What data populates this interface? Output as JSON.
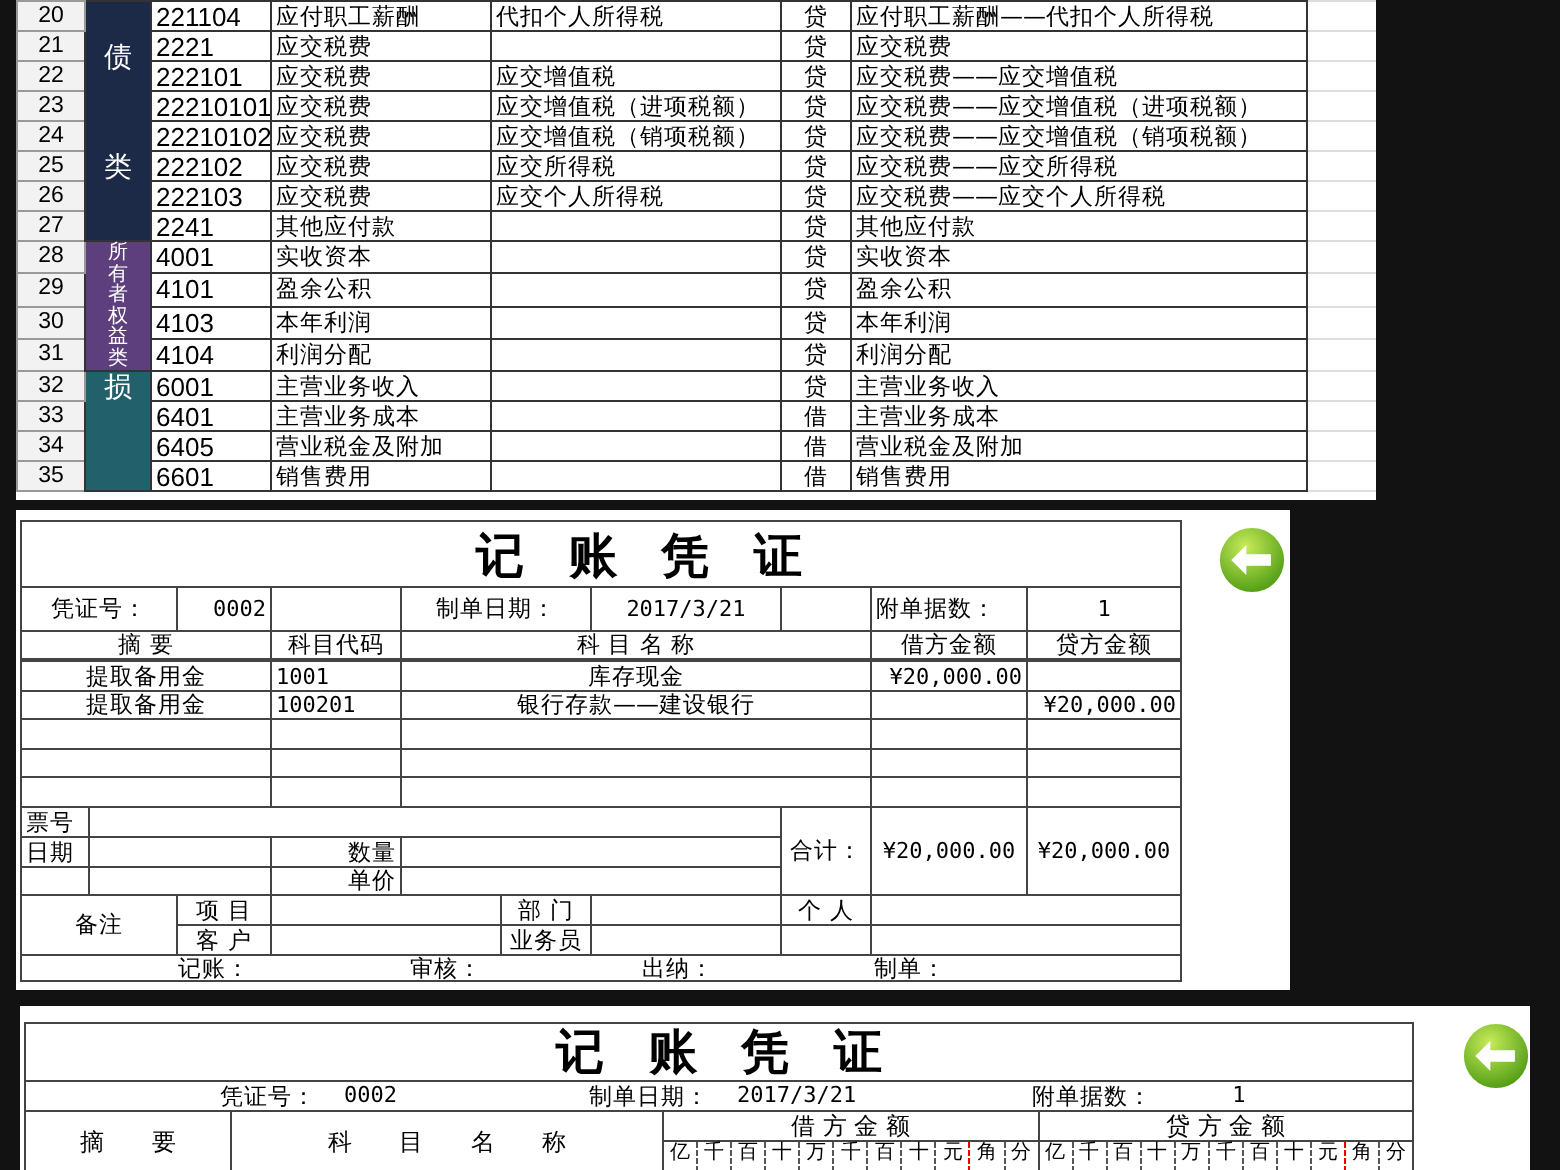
{
  "sheet": {
    "groups": [
      {
        "labels": [
          "债",
          "类"
        ],
        "color": "#1c2a48",
        "rows": [
          {
            "row_number": "20",
            "code": "221104",
            "name": "应付职工薪酬",
            "detail": "代扣个人所得税",
            "direction": "贷",
            "full_name": "应付职工薪酬——代扣个人所得税"
          },
          {
            "row_number": "21",
            "code": "2221",
            "name": "应交税费",
            "direction": "贷",
            "full_name": "应交税费"
          },
          {
            "row_number": "22",
            "code": "222101",
            "name": "应交税费",
            "detail": "应交增值税",
            "direction": "贷",
            "full_name": "应交税费——应交增值税"
          },
          {
            "row_number": "23",
            "code": "22210101",
            "name": "应交税费",
            "detail": "应交增值税（进项税额）",
            "direction": "贷",
            "full_name": "应交税费——应交增值税（进项税额）"
          },
          {
            "row_number": "24",
            "code": "22210102",
            "name": "应交税费",
            "detail": "应交增值税（销项税额）",
            "direction": "贷",
            "full_name": "应交税费——应交增值税（销项税额）"
          },
          {
            "row_number": "25",
            "code": "222102",
            "name": "应交税费",
            "detail": "应交所得税",
            "direction": "贷",
            "full_name": "应交税费——应交所得税"
          },
          {
            "row_number": "26",
            "code": "222103",
            "name": "应交税费",
            "detail": "应交个人所得税",
            "direction": "贷",
            "full_name": "应交税费——应交个人所得税"
          },
          {
            "row_number": "27",
            "code": "2241",
            "name": "其他应付款",
            "direction": "贷",
            "full_name": "其他应付款"
          }
        ]
      },
      {
        "labels": [
          "所有者权益类"
        ],
        "color": "#5e3f7e",
        "rows": [
          {
            "row_number": "28",
            "code": "4001",
            "name": "实收资本",
            "direction": "贷",
            "full_name": "实收资本"
          },
          {
            "row_number": "29",
            "code": "4101",
            "name": "盈余公积",
            "direction": "贷",
            "full_name": "盈余公积"
          },
          {
            "row_number": "30",
            "code": "4103",
            "name": "本年利润",
            "direction": "贷",
            "full_name": "本年利润"
          },
          {
            "row_number": "31",
            "code": "4104",
            "name": "利润分配",
            "direction": "贷",
            "full_name": "利润分配"
          }
        ]
      },
      {
        "labels": [
          "损"
        ],
        "color": "#22606c",
        "rows": [
          {
            "row_number": "32",
            "code": "6001",
            "name": "主营业务收入",
            "direction": "贷",
            "full_name": "主营业务收入"
          },
          {
            "row_number": "33",
            "code": "6401",
            "name": "主营业务成本",
            "direction": "借",
            "full_name": "主营业务成本"
          },
          {
            "row_number": "34",
            "code": "6405",
            "name": "营业税金及附加",
            "direction": "借",
            "full_name": "营业税金及附加"
          },
          {
            "row_number": "35",
            "code": "6601",
            "name": "销售费用",
            "direction": "借",
            "full_name": "销售费用"
          }
        ]
      }
    ]
  },
  "voucher": {
    "title": "记 账 凭 证",
    "number_label": "凭证号：",
    "number": "0002",
    "date_label": "制单日期：",
    "date": "2017/3/21",
    "attachments_label": "附单据数：",
    "attachments": "1",
    "columns": [
      "摘  要",
      "科目代码",
      "科  目  名  称",
      "借方金额",
      "贷方金额"
    ],
    "entries": [
      {
        "summary": "提取备用金",
        "code": "1001",
        "account": "库存现金",
        "debit": "¥20,000.00"
      },
      {
        "summary": "提取备用金",
        "code": "100201",
        "account": "银行存款——建设银行",
        "credit": "¥20,000.00"
      }
    ],
    "ticket_label": "票号",
    "date2_label": "日期",
    "quantity_label": "数量",
    "price_label": "单价",
    "total_label": "合计：",
    "total_debit": "¥20,000.00",
    "total_credit": "¥20,000.00",
    "remarks_label": "备注",
    "project_label": "项  目",
    "customer_label": "客  户",
    "department_label": "部  门",
    "clerk_label": "业务员",
    "personal_label": "个  人",
    "signatures": [
      "记账：",
      "审核：",
      "出纳：",
      "制单："
    ]
  },
  "voucher_detailed": {
    "title": "记 账 凭 证",
    "number_label": "凭证号：",
    "number": "0002",
    "date_label": "制单日期：",
    "date": "2017/3/21",
    "attachments_label": "附单据数：",
    "attachments": "1",
    "summary_header": "摘  要",
    "account_header": "科  目  名  称",
    "debit_header": "借 方 金 额",
    "credit_header": "贷 方 金 额",
    "debit_units": [
      "亿",
      "千",
      "百",
      "十",
      "万",
      "千",
      "百",
      "十",
      "元",
      "角",
      "分"
    ],
    "credit_units": [
      "亿",
      "千",
      "百",
      "十",
      "万",
      "千",
      "百",
      "十",
      "元",
      "角",
      "分"
    ]
  }
}
